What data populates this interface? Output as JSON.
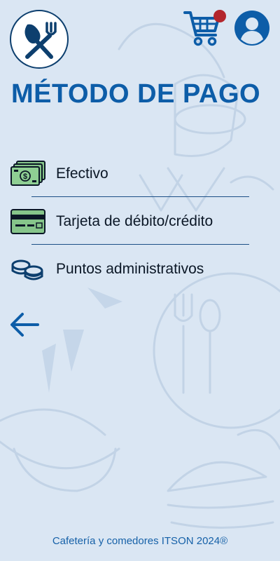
{
  "header": {
    "logo_icon": "utensils-icon",
    "cart_icon": "shopping-cart-icon",
    "profile_icon": "user-avatar-icon",
    "badge_color": "#b3262d"
  },
  "page": {
    "title": "MÉTODO DE PAGO"
  },
  "payment_options": [
    {
      "label": "Efectivo",
      "icon": "cash-icon"
    },
    {
      "label": "Tarjeta de débito/crédito",
      "icon": "credit-card-icon"
    },
    {
      "label": "Puntos administrativos",
      "icon": "coins-icon"
    }
  ],
  "navigation": {
    "back_icon": "arrow-left-icon"
  },
  "footer": {
    "text": "Cafetería y comedores ITSON 2024®"
  },
  "colors": {
    "background": "#dae6f3",
    "primary": "#0d5da8",
    "accent_dark": "#0d3f6e"
  }
}
